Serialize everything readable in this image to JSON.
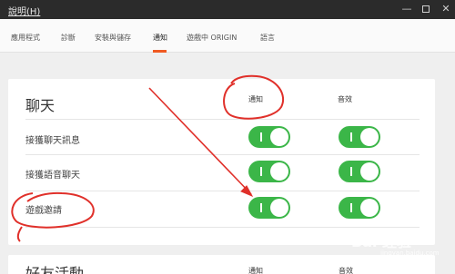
{
  "window": {
    "title": "說明(H)"
  },
  "tabs": [
    {
      "label": "應用程式"
    },
    {
      "label": "診斷"
    },
    {
      "label": "安裝與儲存"
    },
    {
      "label": "通知"
    },
    {
      "label": "遊戲中 ORIGIN"
    },
    {
      "label": "語言"
    }
  ],
  "chat_section": {
    "title": "聊天",
    "col_notify": "通知",
    "col_sound": "音效",
    "rows": [
      {
        "label": "接獲聊天訊息"
      },
      {
        "label": "接獲語音聊天"
      },
      {
        "label": "遊戲邀請"
      }
    ]
  },
  "friends_section": {
    "title": "好友活動",
    "col_notify": "通知",
    "col_sound": "音效"
  },
  "watermark": {
    "text": "Bai 经验",
    "sub": "jingyan.baidu.com"
  },
  "colors": {
    "toggle_on": "#3bb648",
    "active_tab": "#f05a22",
    "annotation_red": "#e0302a",
    "titlebar": "#2b2b2b"
  }
}
